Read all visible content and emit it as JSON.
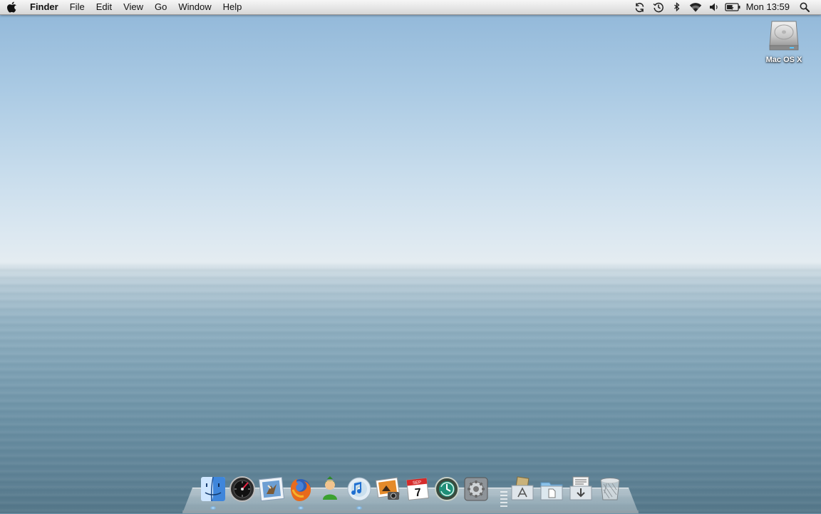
{
  "menubar": {
    "apple_icon": "apple-icon",
    "app_name": "Finder",
    "menus": [
      "File",
      "Edit",
      "View",
      "Go",
      "Window",
      "Help"
    ],
    "status_icons": [
      "sync-icon",
      "time-machine-icon",
      "bluetooth-icon",
      "wifi-icon",
      "volume-icon",
      "battery-icon"
    ],
    "clock": "Mon 13:59",
    "spotlight_icon": "spotlight-search-icon"
  },
  "desktop": {
    "icons": [
      {
        "label": "Mac OS X",
        "icon": "hard-drive-icon"
      }
    ]
  },
  "dock": {
    "apps": [
      {
        "icon": "finder-icon",
        "running": true
      },
      {
        "icon": "dashboard-icon",
        "running": false
      },
      {
        "icon": "mail-icon",
        "running": false
      },
      {
        "icon": "firefox-icon",
        "running": true
      },
      {
        "icon": "chat-icon",
        "running": false
      },
      {
        "icon": "itunes-icon",
        "running": true
      },
      {
        "icon": "iphoto-icon",
        "running": false
      },
      {
        "icon": "calendar-icon",
        "running": false,
        "day": "7",
        "month": "SEP"
      },
      {
        "icon": "time-machine-icon",
        "running": false
      },
      {
        "icon": "system-preferences-icon",
        "running": false
      }
    ],
    "stacks": [
      {
        "icon": "applications-stack-icon"
      },
      {
        "icon": "documents-stack-icon"
      },
      {
        "icon": "downloads-stack-icon"
      },
      {
        "icon": "trash-icon"
      }
    ]
  }
}
